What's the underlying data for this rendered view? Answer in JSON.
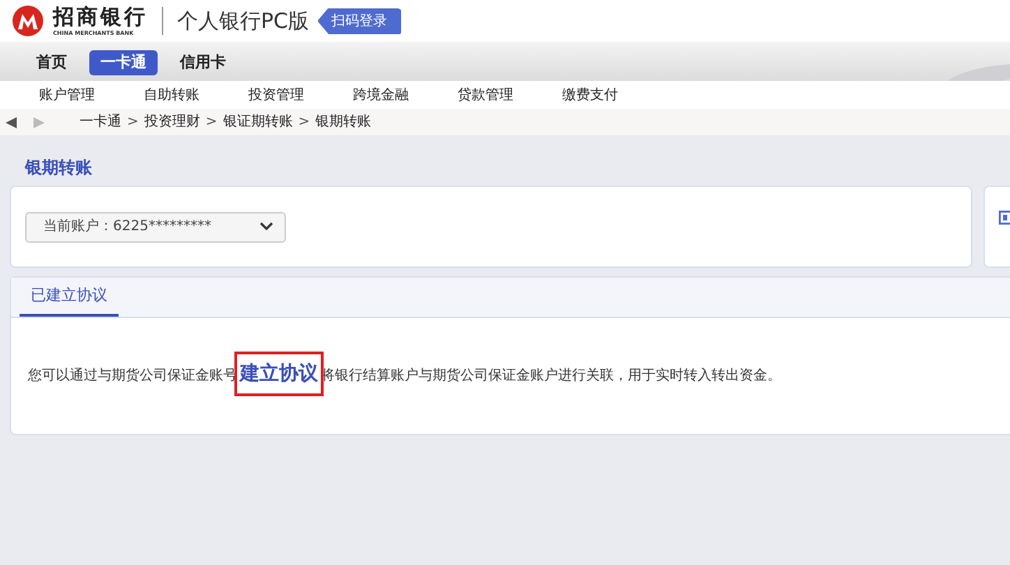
{
  "header": {
    "bank_name": "招商银行",
    "bank_name_en": "CHINA MERCHANTS BANK",
    "product": "个人银行PC版",
    "login_button": "扫码登录"
  },
  "main_tabs": [
    {
      "label": "首页",
      "selected": false
    },
    {
      "label": "一卡通",
      "selected": true
    },
    {
      "label": "信用卡",
      "selected": false
    }
  ],
  "menu": [
    "账户管理",
    "自助转账",
    "投资管理",
    "跨境金融",
    "贷款管理",
    "缴费支付"
  ],
  "breadcrumb": [
    {
      "kind": "link",
      "text": "一卡通"
    },
    {
      "kind": "separator",
      "text": ">"
    },
    {
      "kind": "link",
      "text": "投资理财"
    },
    {
      "kind": "separator",
      "text": ">"
    },
    {
      "kind": "link",
      "text": "银证期转账"
    },
    {
      "kind": "separator",
      "text": ">"
    },
    {
      "kind": "link",
      "text": "银期转账"
    }
  ],
  "page_title": "银期转账",
  "account_select": {
    "label": "当前账户：",
    "value": "6225*********"
  },
  "content_tabs": [
    {
      "label": "已建立协议",
      "selected": true
    }
  ],
  "message": {
    "before": "您可以通过与期货公司保证金账号",
    "link": "建立协议",
    "after": "将银行结算账户与期货公司保证金账户进行关联，用于实时转入转出资金。"
  }
}
